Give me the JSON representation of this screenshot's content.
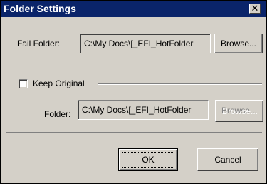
{
  "dialog": {
    "title": "Folder Settings",
    "close_glyph": "✕"
  },
  "fail_folder": {
    "label": "Fail Folder:",
    "value": "C:\\My Docs\\[_EFI_HotFolder",
    "browse_label": "Browse..."
  },
  "keep_original": {
    "label": "Keep Original",
    "checked": false,
    "folder_label": "Folder:",
    "folder_value": "C:\\My Docs\\[_EFI_HotFolder",
    "browse_label": "Browse...",
    "browse_enabled": false
  },
  "buttons": {
    "ok_label": "OK",
    "cancel_label": "Cancel"
  }
}
